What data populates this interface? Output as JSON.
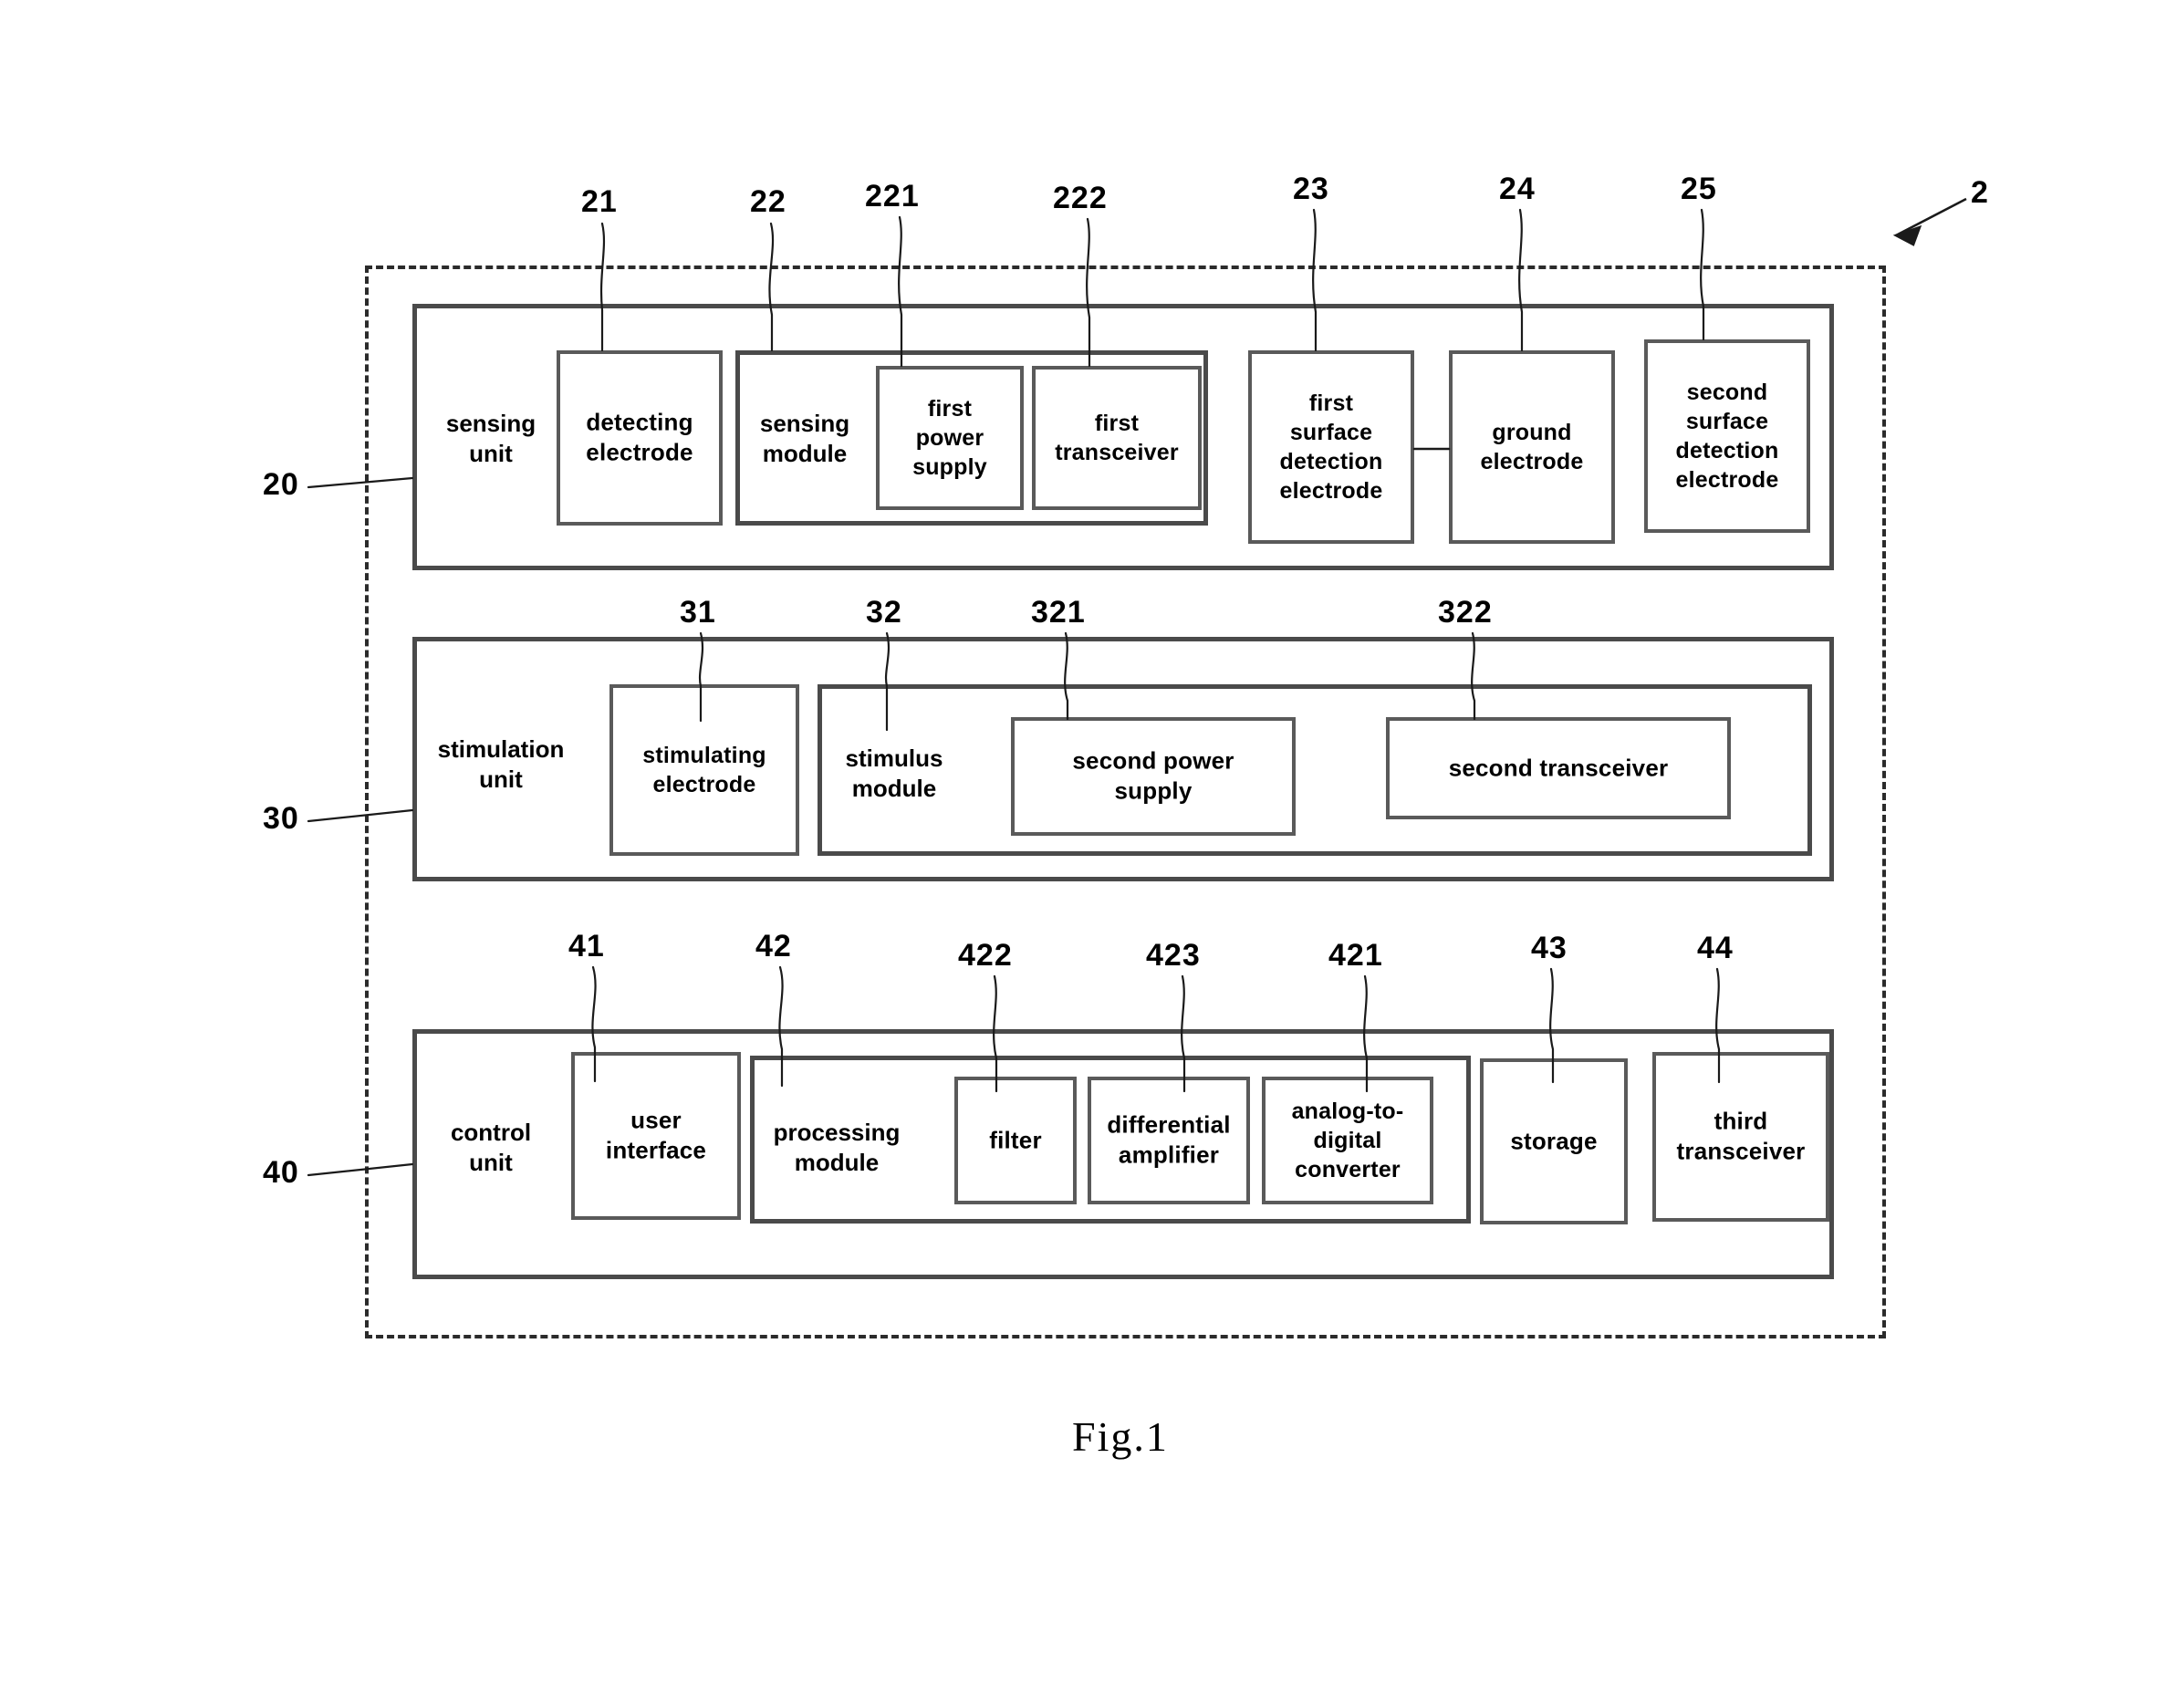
{
  "figure": {
    "caption": "Fig.1",
    "device_ref": "2"
  },
  "units": [
    {
      "ref": "20",
      "name": "sensing\nunit",
      "children": [
        {
          "ref": "21",
          "name": "detecting\nelectrode"
        },
        {
          "ref": "22",
          "name": "sensing\nmodule",
          "children": [
            {
              "ref": "221",
              "name": "first\npower\nsupply"
            },
            {
              "ref": "222",
              "name": "first\ntransceiver"
            }
          ]
        },
        {
          "ref": "23",
          "name": "first\nsurface\ndetection\nelectrode"
        },
        {
          "ref": "24",
          "name": "ground\nelectrode"
        },
        {
          "ref": "25",
          "name": "second\nsurface\ndetection\nelectrode"
        }
      ]
    },
    {
      "ref": "30",
      "name": "stimulation\nunit",
      "children": [
        {
          "ref": "31",
          "name": "stimulating\nelectrode"
        },
        {
          "ref": "32",
          "name": "stimulus\nmodule",
          "children": [
            {
              "ref": "321",
              "name": "second power\nsupply"
            },
            {
              "ref": "322",
              "name": "second transceiver"
            }
          ]
        }
      ]
    },
    {
      "ref": "40",
      "name": "control\nunit",
      "children": [
        {
          "ref": "41",
          "name": "user\ninterface"
        },
        {
          "ref": "42",
          "name": "processing\nmodule",
          "children": [
            {
              "ref": "422",
              "name": "filter"
            },
            {
              "ref": "423",
              "name": "differential\namplifier"
            },
            {
              "ref": "421",
              "name": "analog-to-\ndigital\nconverter"
            }
          ]
        },
        {
          "ref": "43",
          "name": "storage"
        },
        {
          "ref": "44",
          "name": "third\ntransceiver"
        }
      ]
    }
  ],
  "colors": {
    "ink": "#000000",
    "box_stroke": "#4a4a4a",
    "dash_stroke": "#2b2b2b",
    "paper": "#ffffff"
  }
}
